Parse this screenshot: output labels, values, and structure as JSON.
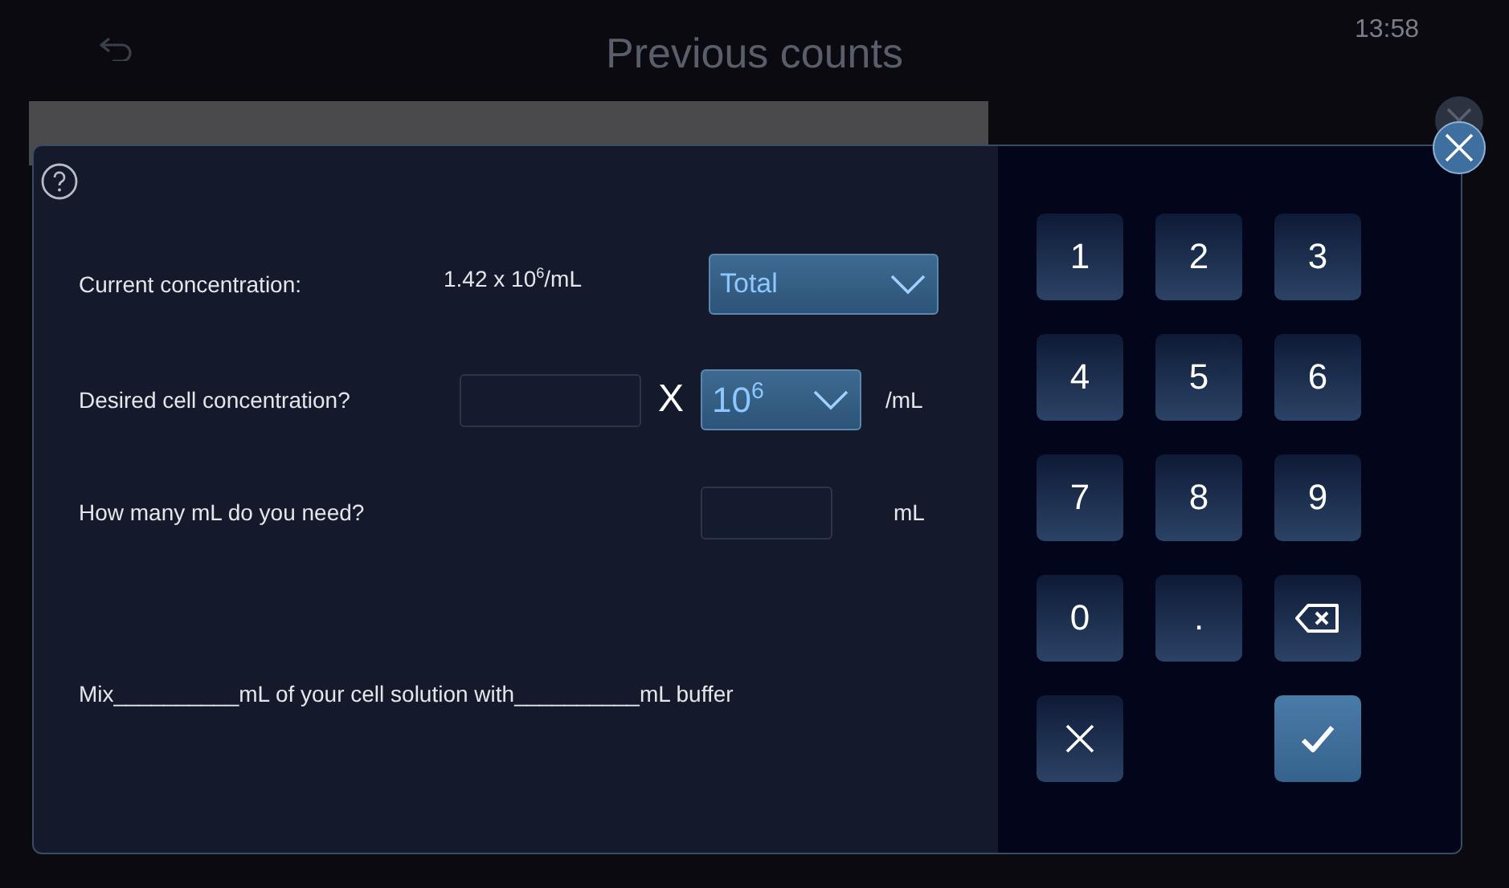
{
  "header": {
    "title": "Previous counts",
    "time": "13:58"
  },
  "dialog": {
    "current": {
      "label": "Current concentration:",
      "value": "1.42 x 10$^{6}$/mL",
      "dropdown": "Total"
    },
    "desired": {
      "label": "Desired cell concentration?",
      "multiplier": "X",
      "exponent": "10$^{6}$",
      "unit": "/mL"
    },
    "volume": {
      "label": "How many mL do you need?",
      "unit": "mL"
    },
    "result": "Mix__________mL of your cell solution with__________mL buffer"
  },
  "keypad": [
    {
      "kind": "key",
      "label": "1"
    },
    {
      "kind": "key",
      "label": "2"
    },
    {
      "kind": "key",
      "label": "3"
    },
    {
      "kind": "key",
      "label": "4"
    },
    {
      "kind": "key",
      "label": "5"
    },
    {
      "kind": "key",
      "label": "6"
    },
    {
      "kind": "key",
      "label": "7"
    },
    {
      "kind": "key",
      "label": "8"
    },
    {
      "kind": "key",
      "label": "9"
    },
    {
      "kind": "key",
      "label": "0"
    },
    {
      "kind": "key",
      "label": "."
    },
    {
      "kind": "backspace"
    },
    {
      "kind": "cancel"
    },
    {
      "kind": "blank"
    },
    {
      "kind": "confirm"
    }
  ]
}
